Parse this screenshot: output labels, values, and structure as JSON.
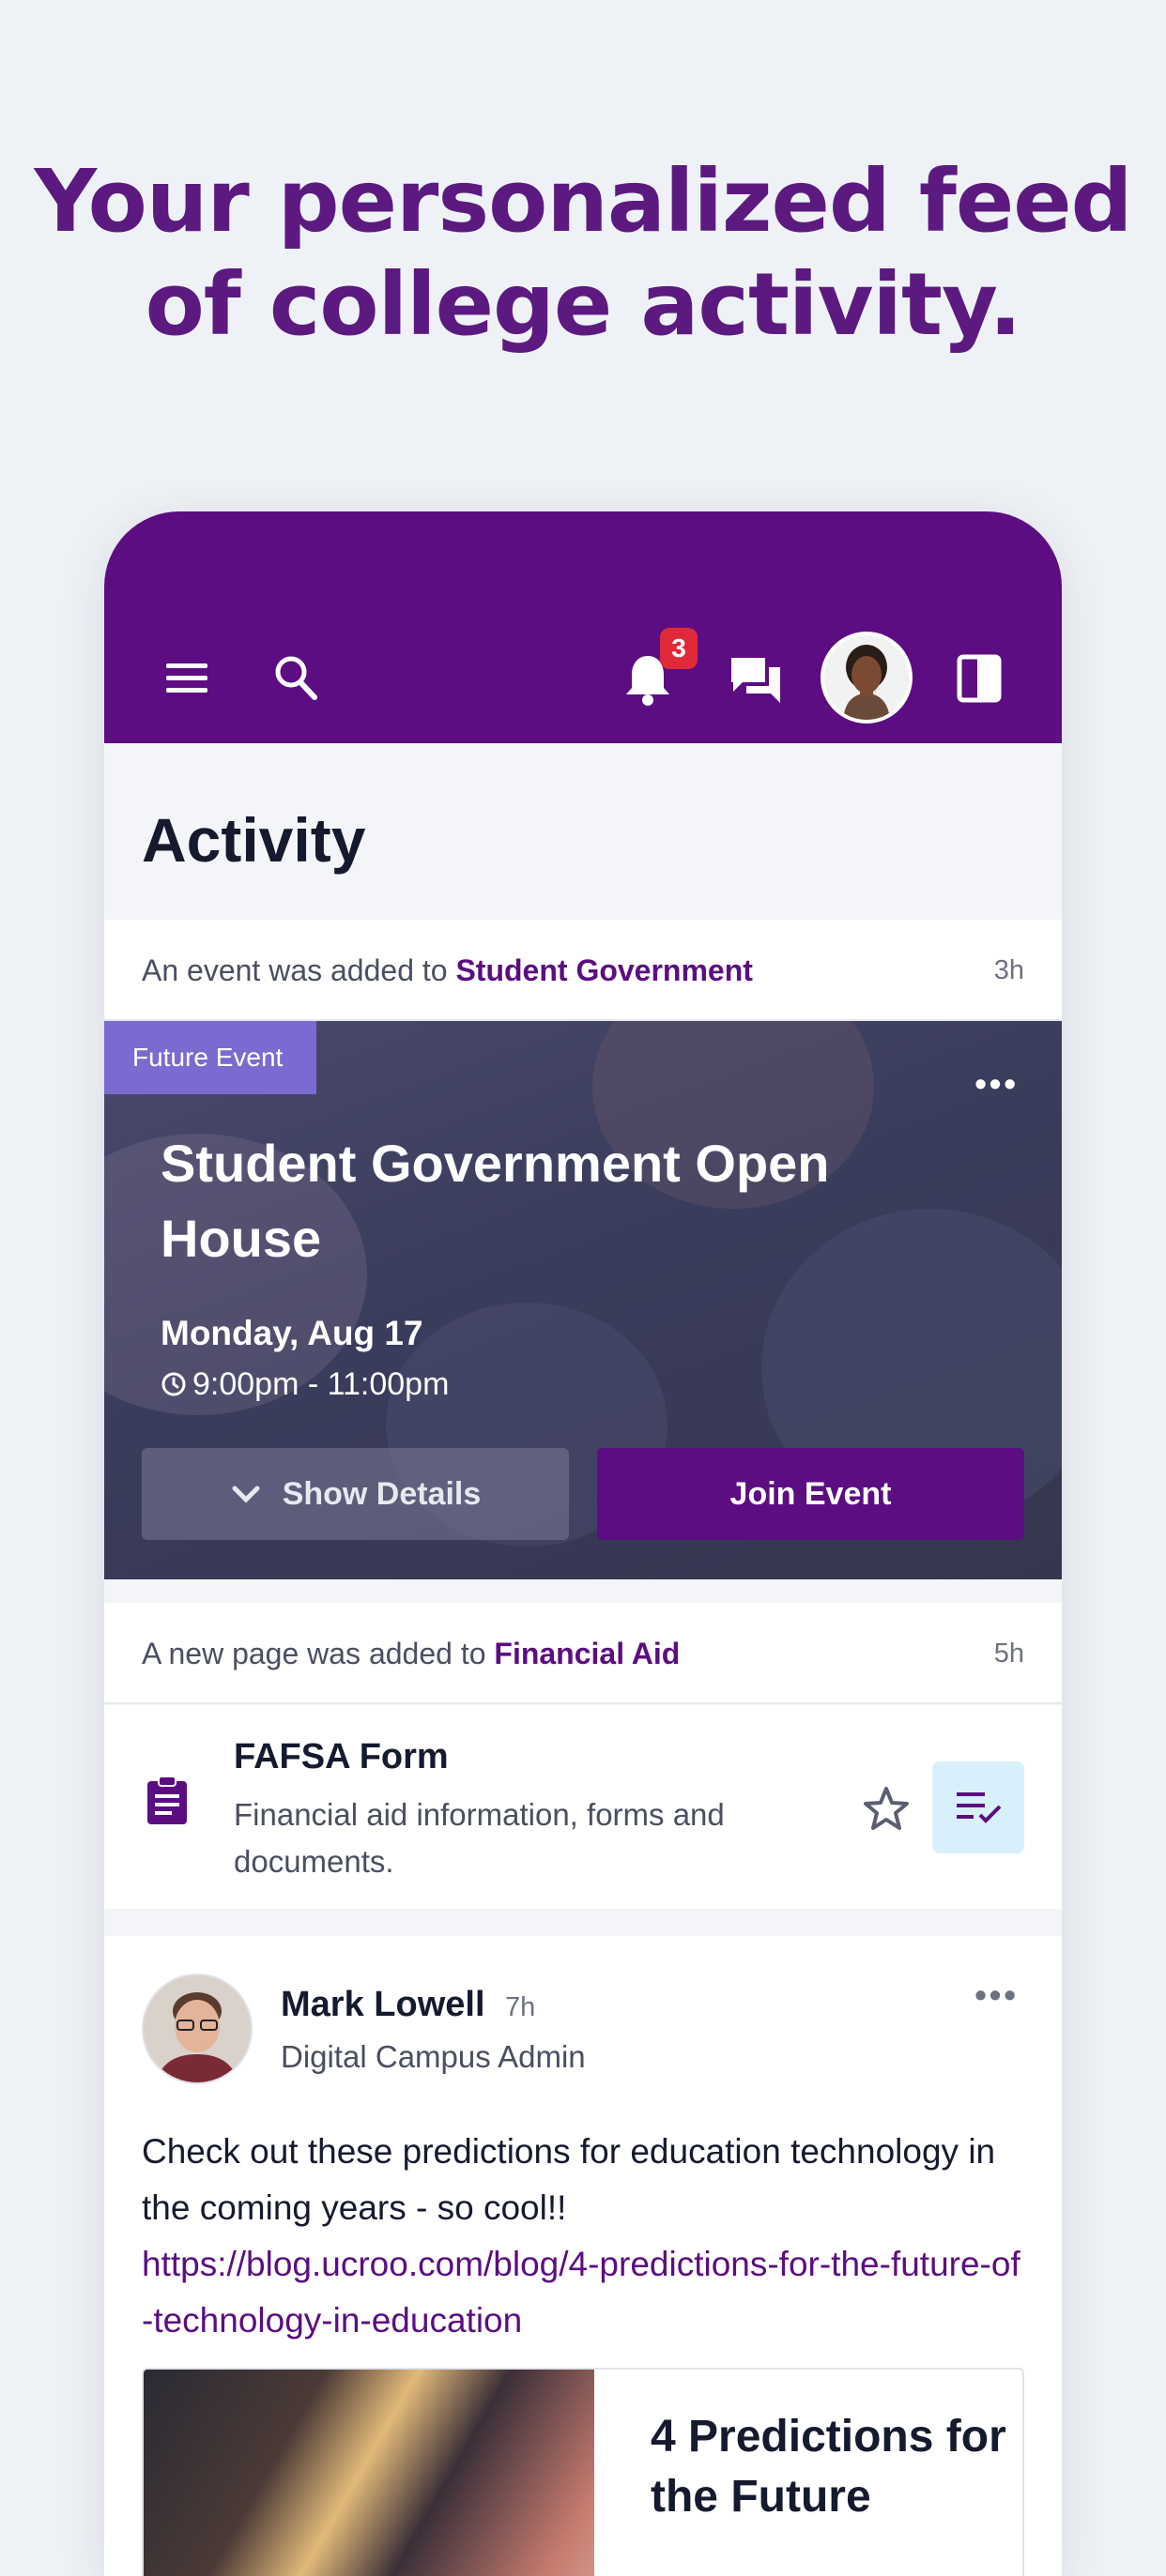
{
  "headline": {
    "line1": "Your personalized feed",
    "line2": "of college activity."
  },
  "topbar": {
    "notification_count": "3",
    "icons": [
      "menu-icon",
      "search-icon",
      "bell-icon",
      "chat-icon",
      "user-avatar",
      "panel-toggle-icon"
    ]
  },
  "page": {
    "title": "Activity"
  },
  "feed": {
    "event_header": {
      "prefix": "An event was added to ",
      "group": "Student Government",
      "time": "3h"
    },
    "event": {
      "tag": "Future Event",
      "title": "Student Government Open House",
      "date": "Monday, Aug 17",
      "time": "9:00pm - 11:00pm",
      "details_button": "Show Details",
      "join_button": "Join Event"
    },
    "page_header": {
      "prefix": "A new page was added to ",
      "group": "Financial Aid",
      "time": "5h"
    },
    "page_item": {
      "title": "FAFSA Form",
      "description": "Financial aid information, forms and documents."
    },
    "post": {
      "author": "Mark Lowell",
      "time": "7h",
      "role": "Digital Campus Admin",
      "text": "Check out these predictions for education technology in the coming years - so cool!!",
      "link": "https://blog.ucroo.com/blog/4-predictions-for-the-future-of-technology-in-education",
      "card_title": "4 Predictions for the Future"
    }
  },
  "colors": {
    "brand": "#5c0d82",
    "headline": "#5c1a80",
    "badge": "#e02a3a",
    "event_tag": "#7b6bd0",
    "task_button_bg": "#d7f0fb"
  }
}
